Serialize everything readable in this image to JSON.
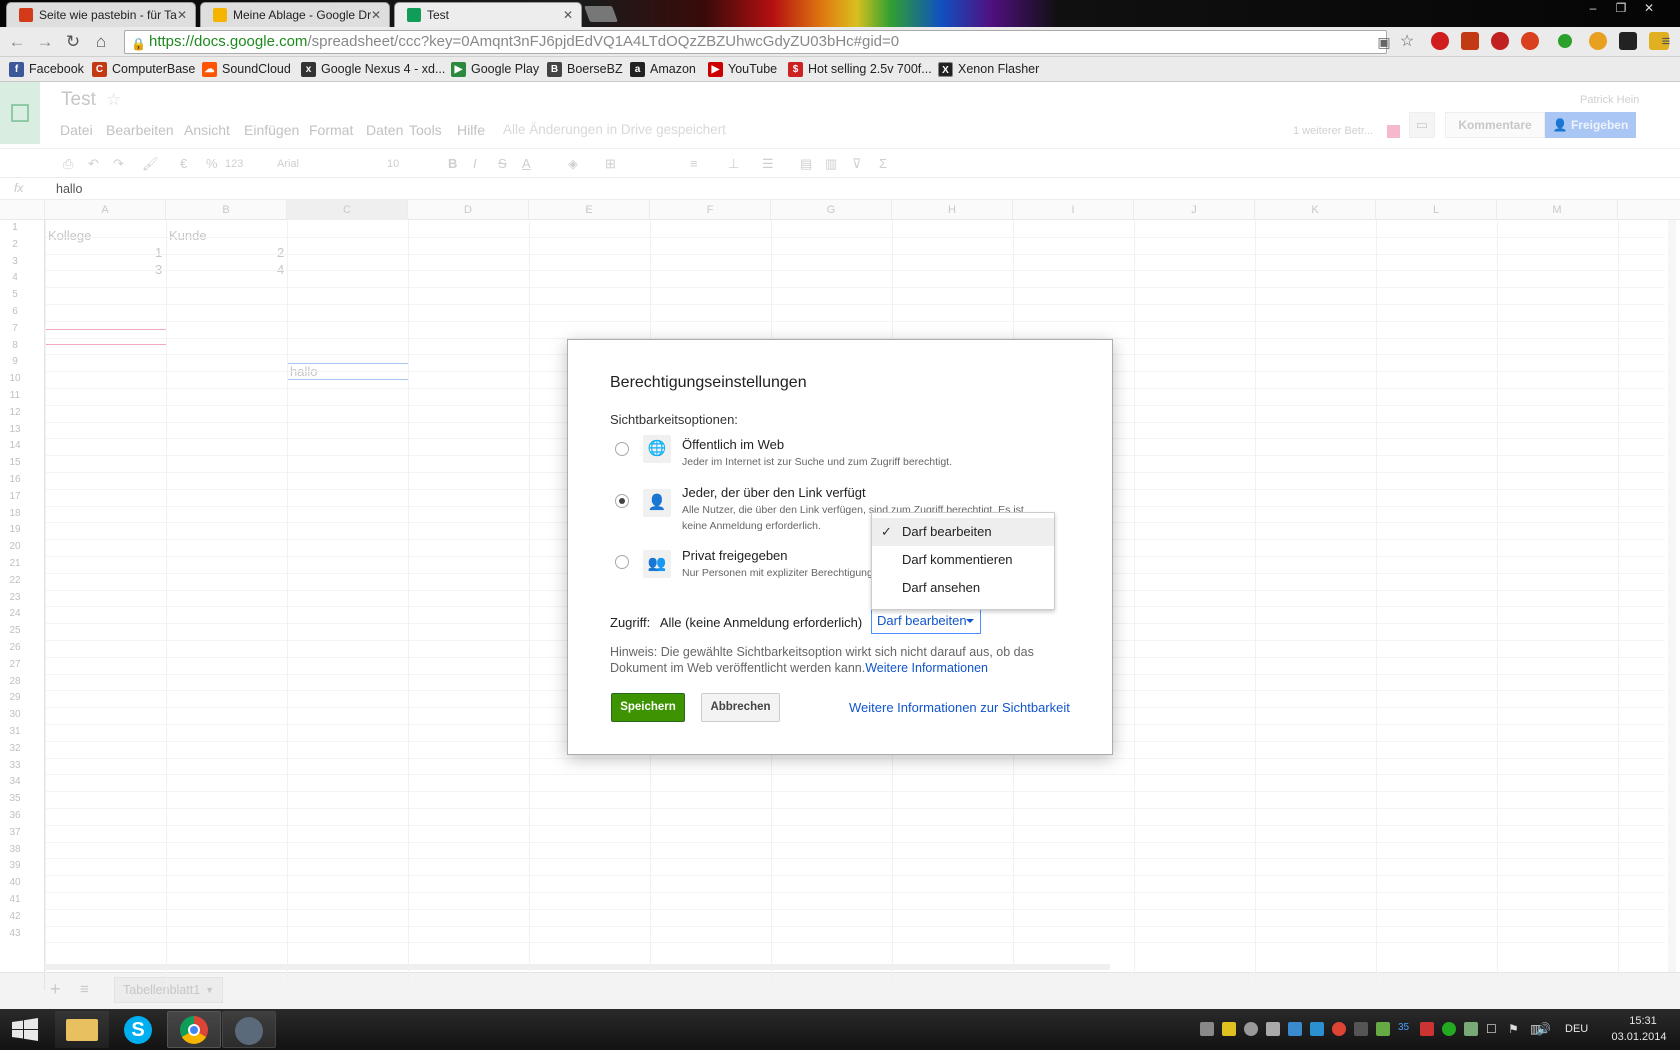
{
  "browser": {
    "tabs": [
      {
        "title": "Seite wie pastebin - für Ta",
        "favicon_color": "#d23a1a"
      },
      {
        "title": "Meine Ablage - Google Dr",
        "favicon_color": "#f4b400"
      },
      {
        "title": "Test",
        "favicon_color": "#0f9d58"
      }
    ],
    "url": "https://docs.google.com/spreadsheet/ccc?key=0Amqnt3nFJ6pjdEdVQ1A4LTdOQzZBZUhwcGdyZU03bHc#gid=0",
    "url_host": "https://docs.google.com",
    "url_path": "/spreadsheet/ccc?key=0Amqnt3nFJ6pjdEdVQ1A4LTdOQzZBZUhwcGdyZU03bHc#gid=0",
    "bookmarks": [
      {
        "label": "Facebook",
        "color": "#3b5998",
        "icon": "f"
      },
      {
        "label": "ComputerBase",
        "color": "#c23a14",
        "icon": "C"
      },
      {
        "label": "SoundCloud",
        "color": "#ff5500",
        "icon": "☁"
      },
      {
        "label": "Google Nexus 4 - xd...",
        "color": "#333333",
        "icon": "x"
      },
      {
        "label": "Google Play",
        "color": "#2b8a3e",
        "icon": "▶"
      },
      {
        "label": "BoerseBZ",
        "color": "#444444",
        "icon": "B"
      },
      {
        "label": "Amazon",
        "color": "#222222",
        "icon": "a"
      },
      {
        "label": "YouTube",
        "color": "#cc0000",
        "icon": "▶"
      },
      {
        "label": "Hot selling 2.5v 700f...",
        "color": "#cc2222",
        "icon": "$"
      },
      {
        "label": "Xenon Flasher",
        "color": "#222222",
        "icon": "X"
      }
    ]
  },
  "docs": {
    "title": "Test",
    "user": "Patrick Hein",
    "menus": [
      "Datei",
      "Bearbeiten",
      "Ansicht",
      "Einfügen",
      "Format",
      "Daten",
      "Tools",
      "Hilfe"
    ],
    "save_status": "Alle Änderungen in Drive gespeichert",
    "collab": "1 weiterer Betr...",
    "comments_btn": "Kommentare",
    "share_btn": "Freigeben",
    "font": "Arial",
    "font_size": "10",
    "number_format": "123",
    "formula_label": "fx",
    "formula_value": "hallo",
    "columns": [
      "A",
      "B",
      "C",
      "D",
      "E",
      "F",
      "G",
      "H",
      "I",
      "J",
      "K",
      "L",
      "M"
    ],
    "cells": [
      {
        "ref": "A1",
        "value": "Kollege"
      },
      {
        "ref": "B1",
        "value": "Kunde"
      },
      {
        "ref": "A2",
        "value": "1"
      },
      {
        "ref": "B2",
        "value": "2"
      },
      {
        "ref": "A3",
        "value": "3"
      },
      {
        "ref": "B3",
        "value": "4"
      },
      {
        "ref": "C9",
        "value": "hallo"
      }
    ],
    "sheet_tab": "Tabellenblatt1"
  },
  "dialog": {
    "title": "Berechtigungseinstellungen",
    "visibility_label": "Sichtbarkeitsoptionen:",
    "options": [
      {
        "title": "Öffentlich im Web",
        "desc": "Jeder im Internet ist zur Suche und zum Zugriff berechtigt.",
        "selected": false,
        "icon": "globe-icon"
      },
      {
        "title": "Jeder, der über den Link verfügt",
        "desc1": "Alle Nutzer, die über den Link verfügen, sind zum Zugriff berechtigt. Es ist",
        "desc2": "keine Anmeldung erforderlich.",
        "selected": true,
        "icon": "link-person-icon"
      },
      {
        "title": "Privat freigegeben",
        "desc": "Nur Personen mit expliziter Berechtigung",
        "selected": false,
        "icon": "people-icon"
      }
    ],
    "access_label": "Zugriff:",
    "access_value": "Alle (keine Anmeldung erforderlich)",
    "access_select": "Darf bearbeiten",
    "hint_1": "Hinweis: Die gewählte Sichtbarkeitsoption wirkt sich nicht darauf aus, ob das",
    "hint_2": "Dokument im Web veröffentlicht werden kann.",
    "hint_link": "Weitere Informationen",
    "save": "Speichern",
    "cancel": "Abbrechen",
    "more_info": "Weitere Informationen zur Sichtbarkeit"
  },
  "dropdown": {
    "items": [
      {
        "label": "Darf bearbeiten",
        "checked": true
      },
      {
        "label": "Darf kommentieren",
        "checked": false
      },
      {
        "label": "Darf ansehen",
        "checked": false
      }
    ]
  },
  "taskbar": {
    "language": "DEU",
    "time": "15:31",
    "date": "03.01.2014",
    "tray_badge": "35"
  }
}
